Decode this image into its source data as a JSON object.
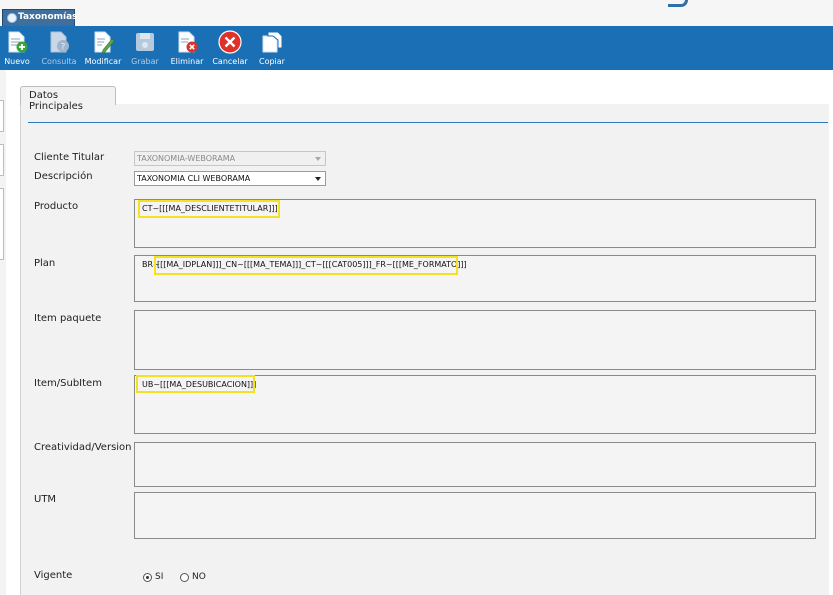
{
  "window_tab": {
    "title": "Taxonomías"
  },
  "toolbar": {
    "nuevo": "Nuevo",
    "consulta": "Consulta",
    "modificar": "Modificar",
    "grabar": "Grabar",
    "eliminar": "Eliminar",
    "cancelar": "Cancelar",
    "copiar": "Copiar"
  },
  "tabs": {
    "datos_principales": "Datos Principales"
  },
  "form": {
    "cliente_titular": {
      "label": "Cliente Titular",
      "value": "TAXONOMIA-WEBORAMA"
    },
    "descripcion": {
      "label": "Descripción",
      "value": "TAXONOMIA CLI WEBORAMA"
    },
    "producto": {
      "label": "Producto",
      "value": "CT~[[[MA_DESCLIENTETITULAR]]]"
    },
    "plan": {
      "label": "Plan",
      "prefix": "BR~",
      "value": "[[[MA_IDPLAN]]]_CN~[[[MA_TEMA]]]_CT~[[[CAT005]]]_FR~[[[ME_FORMATO]]]"
    },
    "item_paquete": {
      "label": "Item paquete",
      "value": ""
    },
    "item_subitem": {
      "label": "Item/SubItem",
      "value": "UB~[[[MA_DESUBICACION]]]"
    },
    "creatividad_version": {
      "label": "Creatividad/Version",
      "value": ""
    },
    "utm": {
      "label": "UTM",
      "value": ""
    },
    "vigente": {
      "label": "Vigente",
      "options": [
        "SI",
        "NO"
      ],
      "selected": "SI"
    }
  },
  "colors": {
    "toolbar_bg": "#1a6fb5",
    "highlight": "#f3e21d",
    "tab_underline": "#2e78c0"
  }
}
